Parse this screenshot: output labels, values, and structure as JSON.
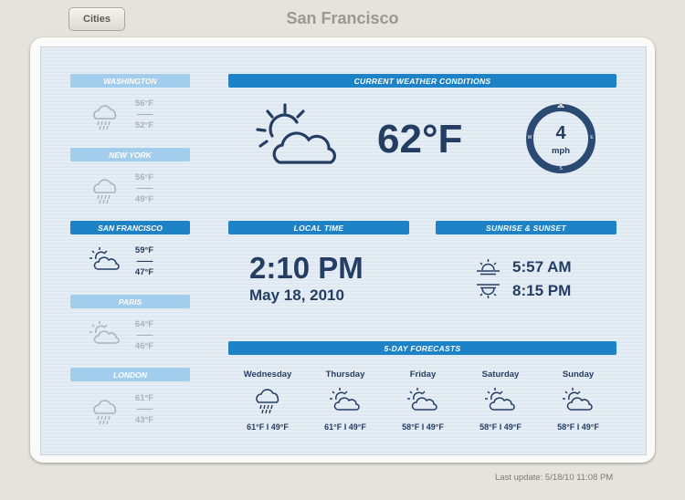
{
  "navbar": {
    "cities_button": "Cities",
    "title": "San Francisco"
  },
  "sidebar": {
    "cities": [
      {
        "name": "WASHINGTON",
        "high": "56°F",
        "sep": "--------",
        "low": "52°F",
        "icon": "rain-cloud-icon",
        "active": false
      },
      {
        "name": "NEW YORK",
        "high": "56°F",
        "sep": "--------",
        "low": "49°F",
        "icon": "rain-cloud-icon",
        "active": false
      },
      {
        "name": "SAN FRANCISCO",
        "high": "59°F",
        "sep": "--------",
        "low": "47°F",
        "icon": "partly-cloudy-icon",
        "active": true
      },
      {
        "name": "PARIS",
        "high": "64°F",
        "sep": "--------",
        "low": "46°F",
        "icon": "partly-cloudy-icon",
        "active": false
      },
      {
        "name": "LONDON",
        "high": "61°F",
        "sep": "--------",
        "low": "43°F",
        "icon": "rain-cloud-icon",
        "active": false
      }
    ]
  },
  "current": {
    "header": "CURRENT WEATHER CONDITIONS",
    "temperature": "62°F",
    "icon": "partly-cloudy-icon",
    "wind": {
      "speed": "4",
      "unit": "mph",
      "n": "N",
      "e": "E",
      "s": "S",
      "w": "W"
    }
  },
  "local_time": {
    "header": "LOCAL TIME",
    "time": "2:10 PM",
    "date": "May 18, 2010"
  },
  "sun": {
    "header": "SUNRISE & SUNSET",
    "sunrise": "5:57 AM",
    "sunset": "8:15 PM"
  },
  "forecast": {
    "header": "5-DAY FORECASTS",
    "days": [
      {
        "day": "Wednesday",
        "temps": "61°F  I  49°F",
        "icon": "rain-cloud-icon"
      },
      {
        "day": "Thursday",
        "temps": "61°F  I  49°F",
        "icon": "partly-cloudy-icon"
      },
      {
        "day": "Friday",
        "temps": "58°F  I  49°F",
        "icon": "partly-cloudy-icon"
      },
      {
        "day": "Saturday",
        "temps": "58°F  I  49°F",
        "icon": "partly-cloudy-icon"
      },
      {
        "day": "Sunday",
        "temps": "58°F  I  49°F",
        "icon": "partly-cloudy-icon"
      }
    ]
  },
  "footer": {
    "last_update": "Last update: 5/18/10 11:08 PM"
  },
  "colors": {
    "accent": "#1e82c7",
    "text_dark": "#243e63",
    "inactive": "#a3cdec"
  }
}
